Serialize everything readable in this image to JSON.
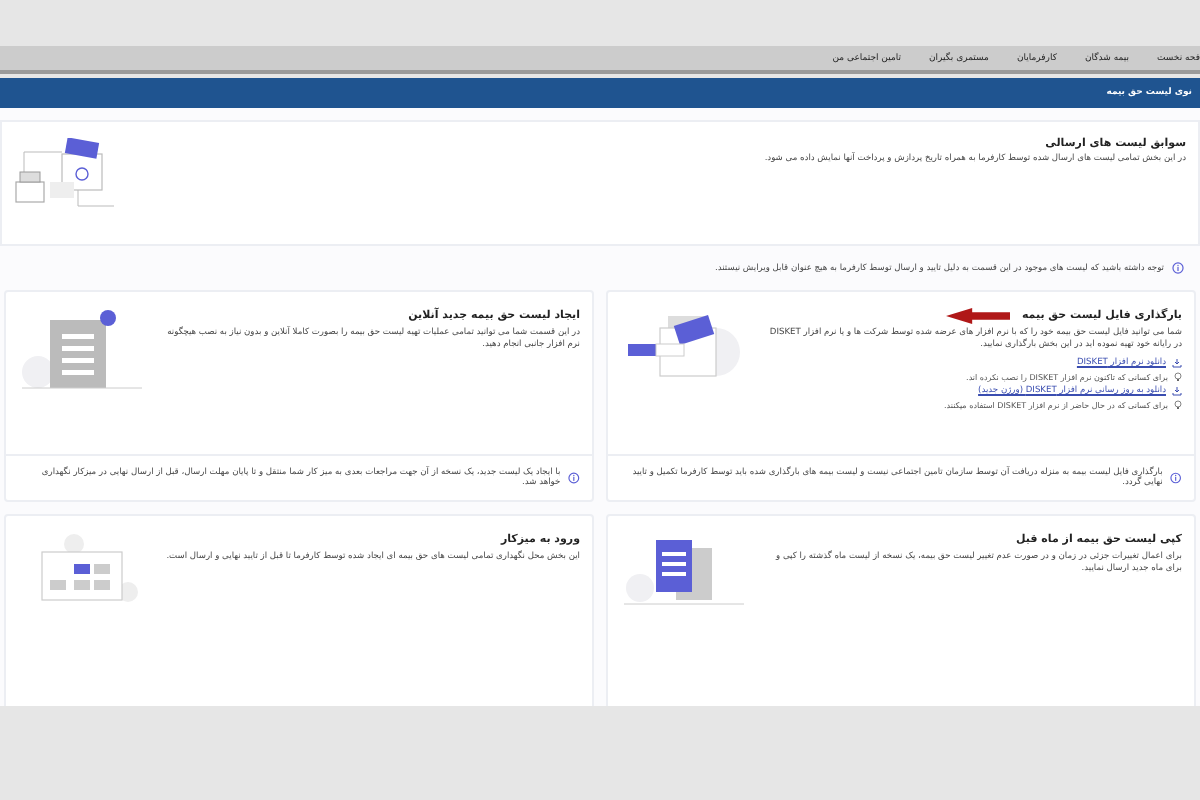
{
  "nav": {
    "items": [
      "فحه نخست",
      "بیمه شدگان",
      "کارفرمایان",
      "مستمری بگیران",
      "تامین اجتماعی من"
    ]
  },
  "page_bar": {
    "title": "نوی لیست حق بیمه"
  },
  "history": {
    "kind": "history",
    "title": "سوابق لیست های ارسالی",
    "description": "در این بخش تمامی لیست های ارسال شده توسط کارفرما به همراه تاریخ پردازش و پرداخت آنها نمایش داده می شود.",
    "note": "توجه داشته باشید که لیست های موجود در این قسمت به دلیل تایید و ارسال توسط کارفرما به هیچ عنوان قابل ویرایش نیستند."
  },
  "cards": [
    {
      "kind": "upload",
      "arrow": true,
      "title": "بارگذاری فایل لیست حق بیمه",
      "description": "شما می توانید فایل لیست حق بیمه خود را که با نرم افزار های عرضه شده توسط شرکت ها و یا نرم افزار DISKET در رایانه خود تهیه نموده اید در این بخش بارگذاری نمایید.",
      "links": [
        {
          "label": "دانلود نرم افزار DISKET",
          "hint": "برای کسانی که تاکنون نرم افزار DISKET را نصب نکرده اند."
        },
        {
          "label": "دانلود به روز رسانی نرم افزار DISKET (ورژن جدید)",
          "hint": "برای کسانی که در حال حاضر از نرم افزار DISKET استفاده میکنند."
        }
      ],
      "note": "بارگذاری فایل لیست بیمه به منزله دریافت آن توسط سازمان تامین اجتماعی نیست و لیست بیمه های بارگذاری شده باید توسط کارفرما تکمیل و تایید نهایی گردد."
    },
    {
      "kind": "create",
      "arrow": false,
      "title": "ایجاد لیست حق بیمه جدید آنلاین",
      "description": "در این قسمت شما می توانید تمامی عملیات تهیه لیست حق بیمه را بصورت کاملا آنلاین و بدون نیاز به نصب هیچگونه نرم افزار جانبی انجام دهید.",
      "note": "با ایجاد یک لیست جدید، یک نسخه از آن جهت مراجعات بعدی به میز کار شما منتقل و تا پایان مهلت ارسال، قبل از ارسال نهایی در میزکار نگهداری خواهد شد."
    },
    {
      "kind": "copy",
      "arrow": false,
      "title": "کپی لیست حق بیمه از ماه قبل",
      "description": "برای اعمال تغییرات جزئی در زمان و در صورت عدم تغییر لیست حق بیمه، یک نسخه از لیست ماه گذشته را کپی و برای ماه جدید ارسال نمایید."
    },
    {
      "kind": "desk",
      "arrow": false,
      "title": "ورود به میزکار",
      "description": "این بخش محل نگهداری تمامی لیست های حق بیمه ای ایجاد شده توسط کارفرما تا قبل از تایید نهایی و ارسال است."
    }
  ]
}
